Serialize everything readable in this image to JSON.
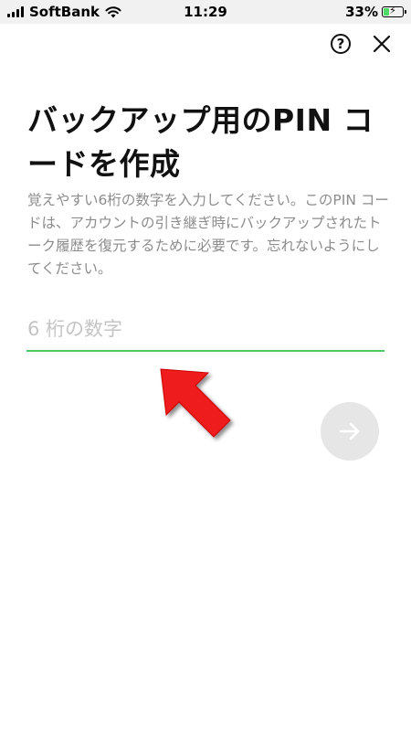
{
  "status_bar": {
    "carrier": "SoftBank",
    "time": "11:29",
    "battery_percent": "33%",
    "battery_level": 0.33,
    "icons": [
      "signal-icon",
      "wifi-icon",
      "battery-charging-icon"
    ]
  },
  "header": {
    "help_symbol": "?",
    "icons": [
      "help-icon",
      "close-icon"
    ]
  },
  "main": {
    "title": "バックアップ用のPIN コードを作成",
    "description": "覚えやすい6桁の数字を入力してください。このPIN コードは、アカウントの引き継ぎ時にバックアップされたトーク履歴を復元するために必要です。忘れないようにしてください。",
    "pin_input": {
      "value": "",
      "placeholder": "6 桁の数字"
    },
    "next_button_icon": "arrow-right-icon"
  },
  "overlay": {
    "annotation_icon": "red-pointer-arrow-icon"
  },
  "colors": {
    "accent": "#4cc764",
    "button_disabled": "#e6e6e6",
    "description_text": "#8c8c8c",
    "annotation": "#ee1c1c"
  }
}
